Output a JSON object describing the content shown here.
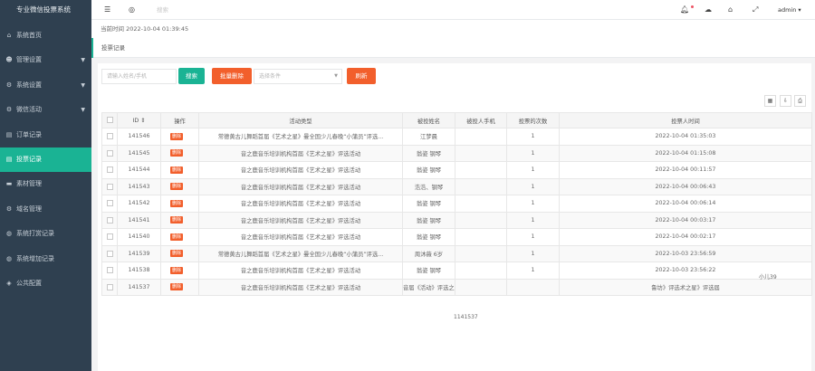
{
  "app": {
    "title": "专业微信投票系统"
  },
  "sidebar": {
    "items": [
      {
        "label": "系统首页",
        "icon": "home-icon",
        "glyph": "⌂",
        "active": false,
        "caret": false
      },
      {
        "label": "管理设置",
        "icon": "users-icon",
        "glyph": "☻",
        "active": false,
        "caret": true
      },
      {
        "label": "系统设置",
        "icon": "gear-icon",
        "glyph": "⚙",
        "active": false,
        "caret": true
      },
      {
        "label": "微信活动",
        "icon": "gear-icon",
        "glyph": "⚙",
        "active": false,
        "caret": true
      },
      {
        "label": "订单记录",
        "icon": "file-icon",
        "glyph": "▤",
        "active": false,
        "caret": false
      },
      {
        "label": "投票记录",
        "icon": "file-icon",
        "glyph": "▤",
        "active": true,
        "caret": false
      },
      {
        "label": "素材管理",
        "icon": "folder-icon",
        "glyph": "▬",
        "active": false,
        "caret": false
      },
      {
        "label": "域名管理",
        "icon": "gear-icon",
        "glyph": "⚙",
        "active": false,
        "caret": false
      },
      {
        "label": "系统打赏记录",
        "icon": "globe-icon",
        "glyph": "◍",
        "active": false,
        "caret": false
      },
      {
        "label": "系统增加记录",
        "icon": "globe-icon",
        "glyph": "◍",
        "active": false,
        "caret": false
      },
      {
        "label": "公共配置",
        "icon": "shield-icon",
        "glyph": "◈",
        "active": false,
        "caret": false
      }
    ]
  },
  "topbar": {
    "search_hint": "搜索",
    "user": "admin ▾"
  },
  "timebar": {
    "text": "当前时间 2022-10-04 01:39:45"
  },
  "breadcrumb": {
    "tab": "投票记录"
  },
  "toolbar": {
    "keyword_placeholder": "请输入姓名/手机",
    "search_button": "搜索",
    "batch_delete_button": "批量删除",
    "condition_placeholder": "选择条件",
    "refresh_button": "刷新"
  },
  "table": {
    "headers": {
      "id": "ID ⇕",
      "action": "操作",
      "activity": "活动类型",
      "voted_name": "被投姓名",
      "voted_phone": "被投人手机",
      "vote_count": "投票的次数",
      "vote_time": "投票人时间"
    },
    "delete_label": "删除",
    "rows": [
      {
        "id": "141546",
        "activity": "常德黄古儿舞蹈首届《艺术之星》曼全国少儿春晚“小蒲员”评选...",
        "name": "江梦晨",
        "phone": "",
        "count": "1",
        "time": "2022-10-04 01:35:03"
      },
      {
        "id": "141545",
        "activity": "音之鹿音乐培训机构首届《艺术之星》评选活动",
        "name": "翁姿 钢琴",
        "phone": "",
        "count": "1",
        "time": "2022-10-04 01:15:08"
      },
      {
        "id": "141544",
        "activity": "音之鹿音乐培训机构首届《艺术之星》评选活动",
        "name": "翁姿 钢琴",
        "phone": "",
        "count": "1",
        "time": "2022-10-04 00:11:57"
      },
      {
        "id": "141543",
        "activity": "音之鹿音乐培训机构首届《艺术之星》评选活动",
        "name": "浩浩、钢琴",
        "phone": "",
        "count": "1",
        "time": "2022-10-04 00:06:43"
      },
      {
        "id": "141542",
        "activity": "音之鹿音乐培训机构首届《艺术之星》评选活动",
        "name": "翁姿 钢琴",
        "phone": "",
        "count": "1",
        "time": "2022-10-04 00:06:14"
      },
      {
        "id": "141541",
        "activity": "音之鹿音乐培训机构首届《艺术之星》评选活动",
        "name": "翁姿 钢琴",
        "phone": "",
        "count": "1",
        "time": "2022-10-04 00:03:17"
      },
      {
        "id": "141540",
        "activity": "音之鹿音乐培训机构首届《艺术之星》评选活动",
        "name": "翁姿 钢琴",
        "phone": "",
        "count": "1",
        "time": "2022-10-04 00:02:17"
      },
      {
        "id": "141539",
        "activity": "常德黄古儿舞蹈首届《艺术之星》曼全国少儿春晚“小蒲员”评选...",
        "name": "周沐薇 6岁",
        "phone": "",
        "count": "1",
        "time": "2022-10-03 23:56:59"
      },
      {
        "id": "141538",
        "activity": "音之鹿音乐培训机构首届《艺术之星》评选活动",
        "name": "翁姿 钢琴",
        "phone": "",
        "count": "1",
        "time": "2022-10-03 23:56:22"
      },
      {
        "id": "141537",
        "activity": "音之鹿音乐培训机构首届《艺术之星》评选活动",
        "name": "音届《活动》评选之星》评选活...",
        "phone": "",
        "count": "",
        "time": "鲁坊》评选术之星》评选届"
      }
    ],
    "stray": {
      "a": "1141537",
      "b": "小儿39"
    }
  },
  "colors": {
    "sidebar": "#2f4050",
    "accent": "#1ab394",
    "orange": "#f25f2c"
  }
}
